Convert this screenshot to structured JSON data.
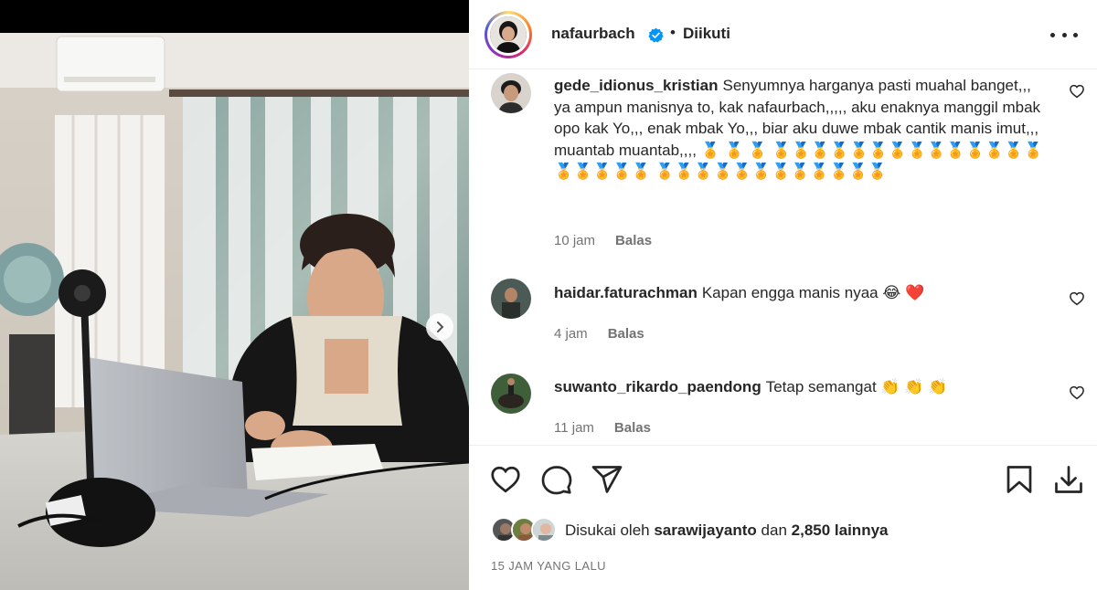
{
  "post": {
    "author": "nafaurbach",
    "follow_status": "Diikuti",
    "separator": "•",
    "liked_by_prefix": "Disukai oleh",
    "liked_by_user": "sarawijayanto",
    "liked_by_and": "dan",
    "liked_by_others": "2,850 lainnya",
    "time_ago": "15 JAM YANG LALU"
  },
  "comments": [
    {
      "user": "gede_idionus_kristian",
      "text": "Senyumnya harganya pasti muahal banget,,, ya ampun manisnya to, kak nafaurbach,,,,, aku enaknya manggil mbak opo kak Yo,,, enak mbak Yo,,, biar aku duwe mbak cantik manis imut,,, muantab muantab,,,, 🏅 🏅 🏅 🏅🏅🏅🏅🏅🏅🏅🏅🏅🏅🏅🏅🏅🏅🏅🏅🏅🏅🏅 🏅🏅🏅🏅🏅🏅🏅🏅🏅🏅🏅🏅",
      "time": "10 jam",
      "reply": "Balas"
    },
    {
      "user": "haidar.faturachman",
      "text": "Kapan engga manis nyaa 😂 ❤️",
      "time": "4 jam",
      "reply": "Balas"
    },
    {
      "user": "suwanto_rikardo_paendong",
      "text": "Tetap semangat 👏 👏 👏",
      "time": "11 jam",
      "reply": "Balas"
    }
  ],
  "icons": {
    "more": "more-horizontal-icon",
    "verified": "verified-badge-icon",
    "like": "heart-icon",
    "comment": "comment-icon",
    "share": "send-icon",
    "save": "bookmark-icon",
    "download": "download-icon",
    "next": "chevron-right-icon"
  },
  "colors": {
    "verified": "#0095f6",
    "text": "#262626",
    "muted": "#737373",
    "divider": "#efefef"
  }
}
